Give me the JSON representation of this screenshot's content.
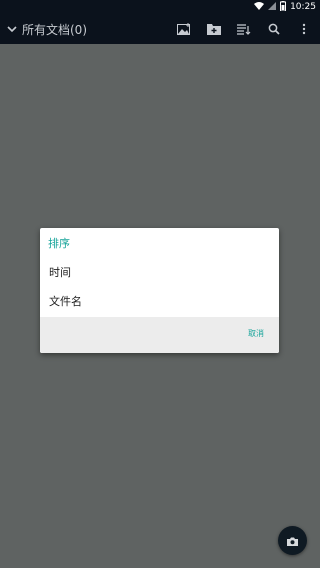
{
  "status_bar": {
    "time": "10:25",
    "icons": [
      "wifi-icon",
      "signal-icon",
      "battery-icon"
    ]
  },
  "toolbar": {
    "title": "所有文档(0)",
    "actions": [
      "image-add-icon",
      "folder-add-icon",
      "sort-icon",
      "search-icon",
      "more-vert-icon"
    ]
  },
  "dialog": {
    "title": "排序",
    "options": [
      {
        "label": "时间"
      },
      {
        "label": "文件名"
      }
    ],
    "cancel_label": "取消"
  },
  "fab": {
    "icon": "camera-icon"
  },
  "colors": {
    "accent": "#17a49a",
    "bar_bg": "#0b121c",
    "scrim": "#5f6362"
  }
}
